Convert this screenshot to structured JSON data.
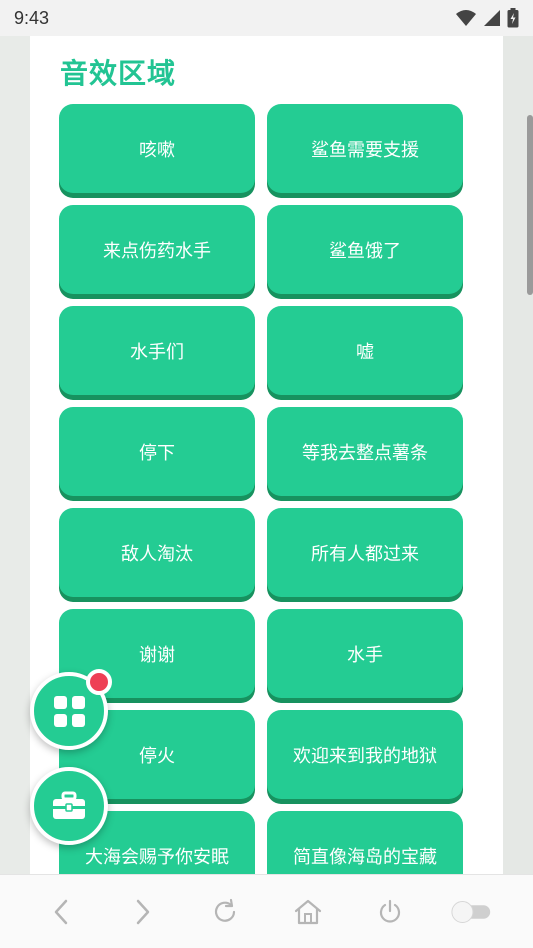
{
  "status_bar": {
    "time": "9:43"
  },
  "section": {
    "title": "音效区域"
  },
  "sound_buttons": [
    {
      "label": "咳嗽"
    },
    {
      "label": "鲨鱼需要支援"
    },
    {
      "label": "来点伤药水手"
    },
    {
      "label": "鲨鱼饿了"
    },
    {
      "label": "水手们"
    },
    {
      "label": "嘘"
    },
    {
      "label": "停下"
    },
    {
      "label": "等我去整点薯条"
    },
    {
      "label": "敌人淘汰"
    },
    {
      "label": "所有人都过来"
    },
    {
      "label": "谢谢"
    },
    {
      "label": "水手"
    },
    {
      "label": "停火"
    },
    {
      "label": "欢迎来到我的地狱"
    },
    {
      "label": "大海会赐予你安眠"
    },
    {
      "label": "简直像海岛的宝藏"
    }
  ],
  "colors": {
    "accent": "#24cc93",
    "accent_shadow": "#17925f",
    "badge": "#ee3f55"
  },
  "icons": {
    "fab_apps": "apps-grid-icon",
    "fab_tools": "toolbox-icon",
    "nav": [
      "back-icon",
      "forward-icon",
      "refresh-icon",
      "home-icon",
      "power-icon",
      "toggle-icon"
    ]
  }
}
